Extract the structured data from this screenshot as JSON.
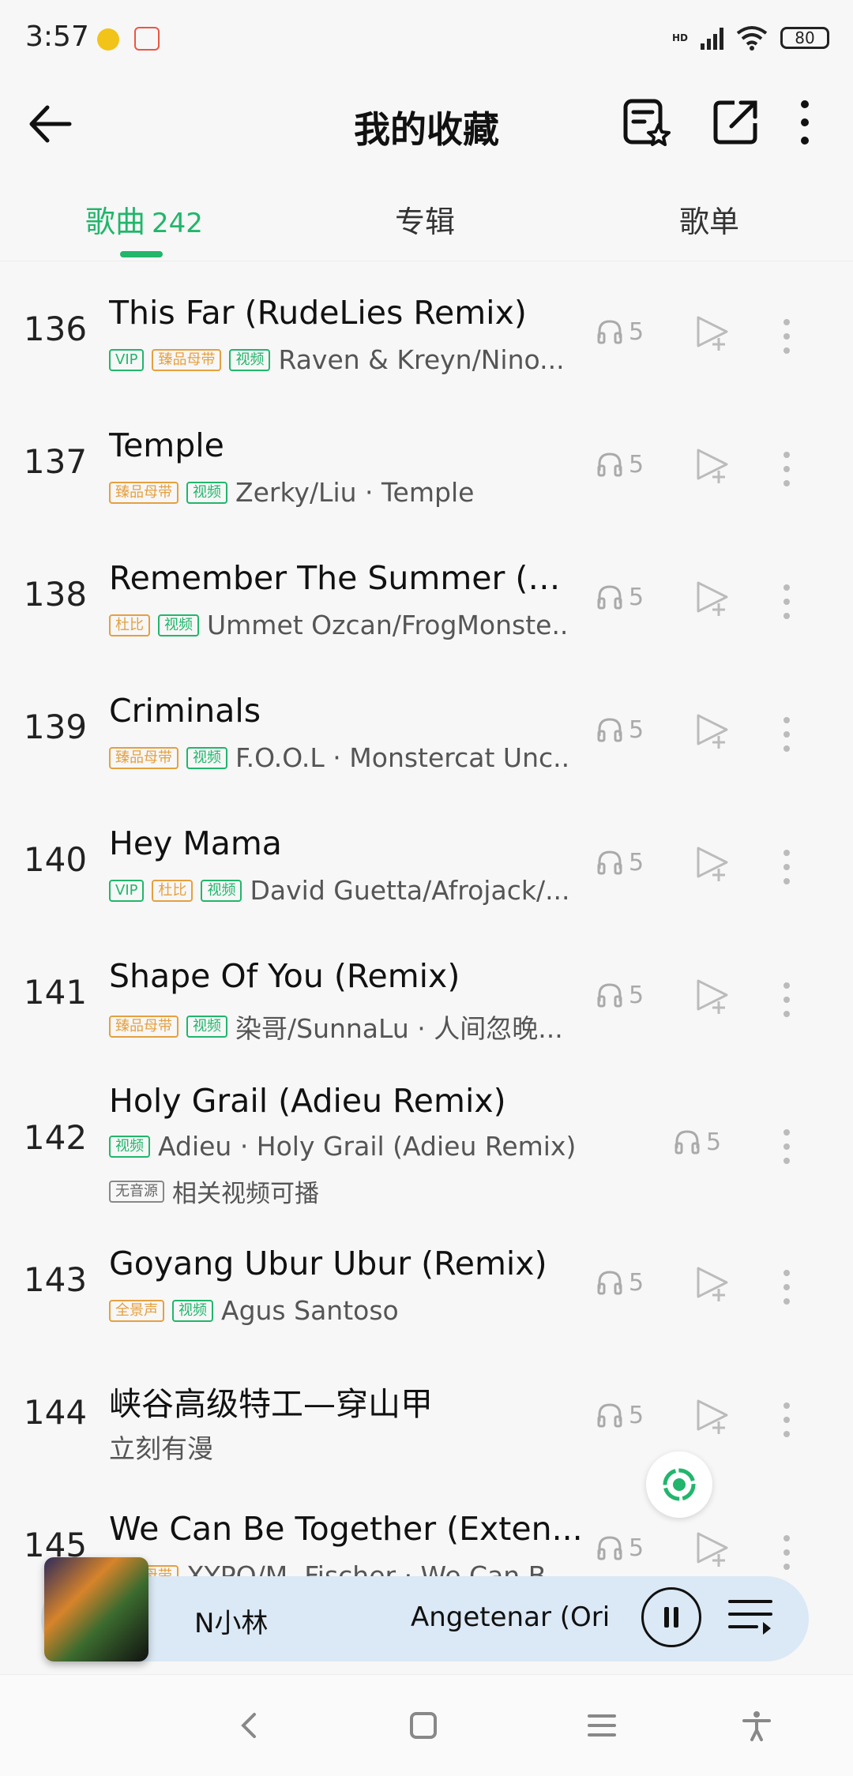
{
  "status": {
    "time": "3:57",
    "network": "HD",
    "battery": "80"
  },
  "header": {
    "title": "我的收藏"
  },
  "tabs": [
    {
      "label": "歌曲",
      "count": "242"
    },
    {
      "label": "专辑"
    },
    {
      "label": "歌单"
    }
  ],
  "songs": [
    {
      "index": "136",
      "title": "This Far (RudeLies Remix)",
      "badges": [
        "VIP",
        "臻品母带",
        "视频"
      ],
      "artist": "Raven & Kreyn/Nino...",
      "listens": "5"
    },
    {
      "index": "137",
      "title": "Temple",
      "badges": [
        "臻品母带",
        "视频"
      ],
      "artist": "Zerky/Liu · Temple",
      "listens": "5"
    },
    {
      "index": "138",
      "title": "Remember The Summer (f...",
      "badges": [
        "杜比",
        "视频"
      ],
      "artist": "Ummet Ozcan/FrogMonste...",
      "listens": "5"
    },
    {
      "index": "139",
      "title": "Criminals",
      "badges": [
        "臻品母带",
        "视频"
      ],
      "artist": "F.O.O.L · Monstercat Unc...",
      "listens": "5"
    },
    {
      "index": "140",
      "title": "Hey Mama",
      "badges": [
        "VIP",
        "杜比",
        "视频"
      ],
      "artist": "David Guetta/Afrojack/...",
      "listens": "5"
    },
    {
      "index": "141",
      "title": "Shape Of You (Remix)",
      "badges": [
        "臻品母带",
        "视频"
      ],
      "artist": "染哥/SunnaLu · 人间忽晚...",
      "listens": "5"
    },
    {
      "index": "142",
      "title": "Holy Grail (Adieu Remix)",
      "badges": [
        "视频"
      ],
      "artist": "Adieu · Holy Grail (Adieu Remix)",
      "listens": "5",
      "note_badge": "无音源",
      "note": "相关视频可播"
    },
    {
      "index": "143",
      "title": "Goyang Ubur Ubur (Remix)",
      "badges": [
        "全景声",
        "视频"
      ],
      "artist": "Agus Santoso",
      "listens": "5"
    },
    {
      "index": "144",
      "title": "峡谷高级特工—穿山甲",
      "badges": [],
      "artist": "立刻有漫",
      "listens": "5"
    },
    {
      "index": "145",
      "title": "We Can Be Together (Exten...",
      "badges": [
        "臻品母带"
      ],
      "artist": "XYPO/M. Fischer · We Can B...",
      "listens": "5"
    }
  ],
  "player": {
    "artist_fragment": "N小林",
    "song_fragment": "Angetenar (Ori"
  },
  "colors": {
    "accent": "#21b66b",
    "gold": "#e5a040",
    "player_bg": "#dbe8f5"
  }
}
